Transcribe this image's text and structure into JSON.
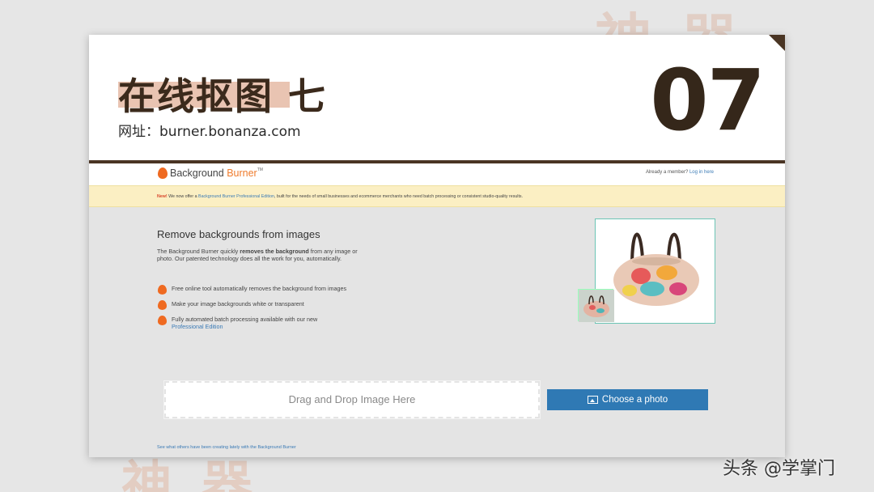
{
  "background": {
    "watermark_top": "神 器",
    "watermark_bottom": "神 器"
  },
  "slide": {
    "title": "在线抠图 七",
    "url": "网址：burner.bonanza.com",
    "number": "07",
    "colors": {
      "title": "#3b2a1c",
      "highlight": "#e9c4b2",
      "divider": "#4a3524"
    }
  },
  "site": {
    "logo": {
      "part1": "Background",
      "part2": "Burner",
      "tm": "TM"
    },
    "member_text": "Already a member?",
    "login_link": "Log in here",
    "notice": {
      "new_label": "New!",
      "text1": " We now offer a ",
      "link": "Background Burner Professional Edition",
      "text2": ", built for the needs of small businesses and ecommerce merchants who need batch processing or consistent studio-quality results."
    },
    "headline": "Remove backgrounds from images",
    "description": {
      "part1": "The Background Burner quickly ",
      "bold": "removes the background",
      "part2": " from any image or photo. Our patented technology does all the work for you, automatically."
    },
    "bullets": [
      {
        "text": "Free online tool automatically removes the background from images"
      },
      {
        "text": "Make your image backgrounds white or transparent"
      },
      {
        "text": "Fully automated batch processing available with our new",
        "link": "Professional Edition"
      }
    ],
    "dropzone_label": "Drag and Drop Image Here",
    "choose_button": "Choose a photo",
    "see_others": "See what others have been creating lately with the Background Burner",
    "colors": {
      "accent": "#ef6a21",
      "link": "#3a7ab5",
      "button": "#2f79b4",
      "notice_bg": "#fbefc3"
    }
  },
  "source_mark": "头条 @学掌门"
}
